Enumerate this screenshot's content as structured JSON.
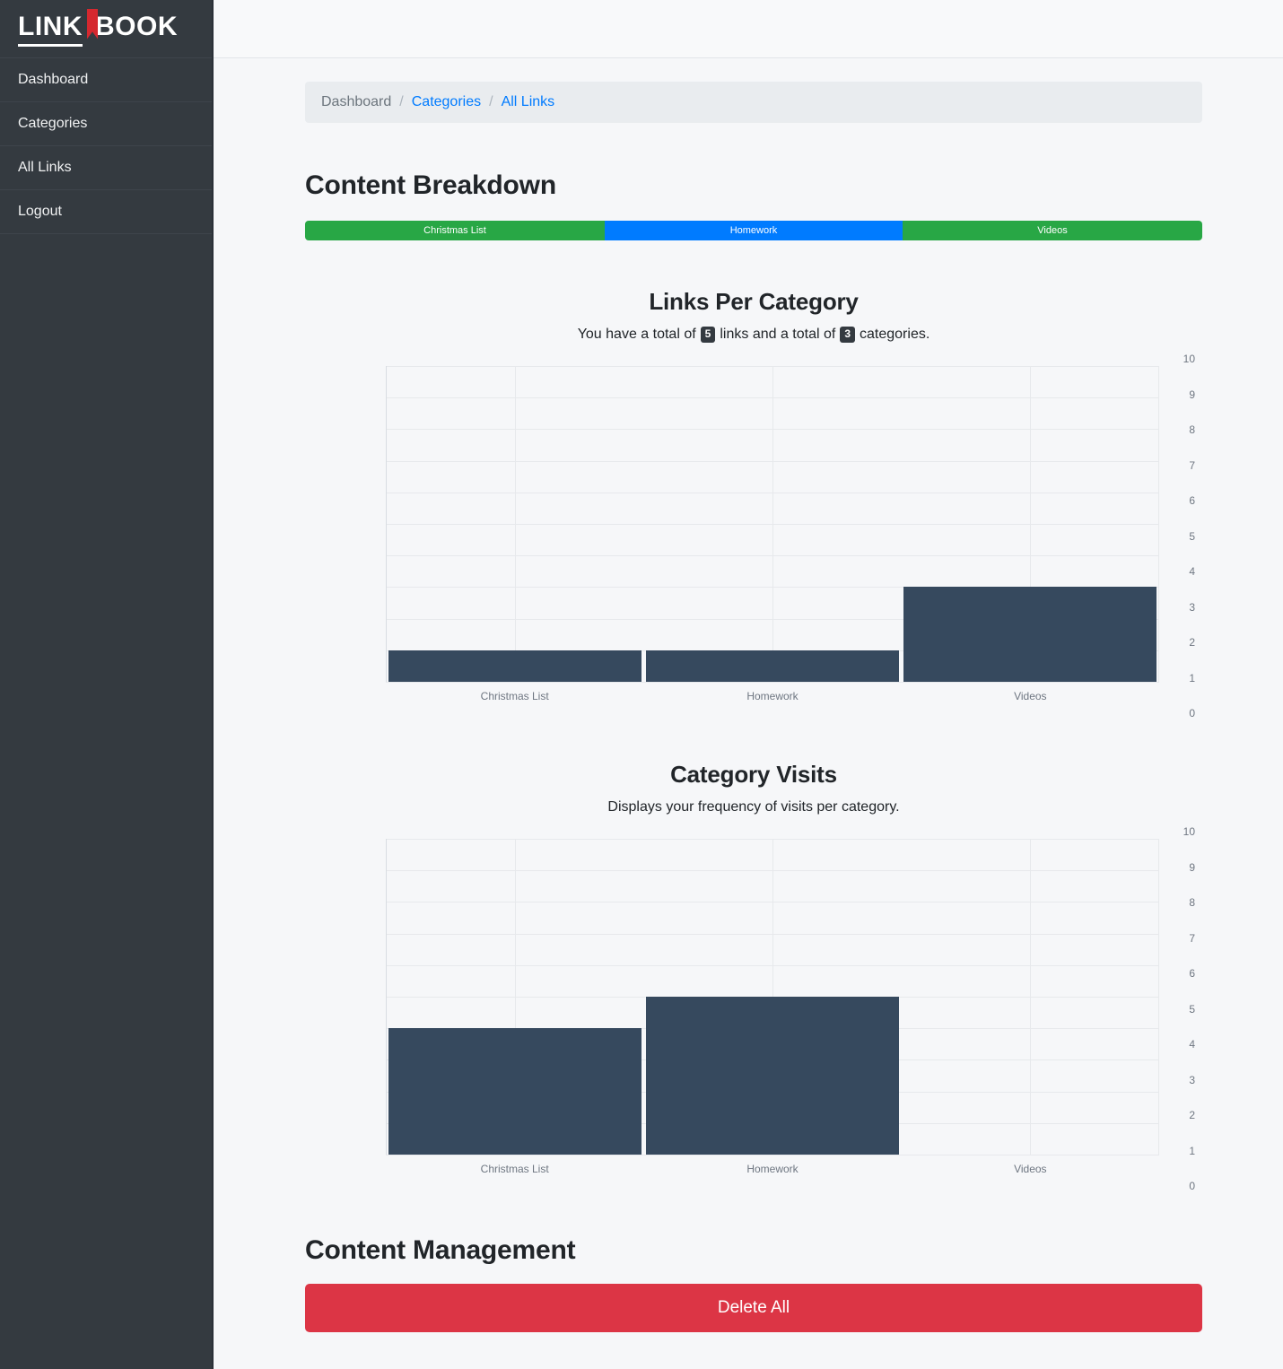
{
  "brand": {
    "part1": "LINK",
    "part2": "BOOK",
    "icon": "bookmark-icon",
    "accent_color": "#d5282f"
  },
  "sidebar": {
    "background": "#343a40",
    "items": [
      {
        "label": "Dashboard",
        "key": "dashboard"
      },
      {
        "label": "Categories",
        "key": "categories"
      },
      {
        "label": "All Links",
        "key": "all-links"
      },
      {
        "label": "Logout",
        "key": "logout"
      }
    ]
  },
  "breadcrumb": {
    "items": [
      {
        "label": "Dashboard",
        "is_link": false
      },
      {
        "label": "Categories",
        "is_link": true
      },
      {
        "label": "All Links",
        "is_link": true
      }
    ],
    "separator": "/",
    "link_color": "#007bff",
    "text_color": "#6c757d"
  },
  "page": {
    "title": "Content Breakdown"
  },
  "segment_bar": {
    "segments": [
      {
        "label": "Christmas List",
        "color": "#28a745",
        "percent": 33.4
      },
      {
        "label": "Homework",
        "color": "#007bff",
        "percent": 33.2
      },
      {
        "label": "Videos",
        "color": "#28a745",
        "percent": 33.4
      }
    ]
  },
  "chart_data": [
    {
      "type": "bar",
      "title": "Links Per Category",
      "subtitle_parts": [
        "You have a total of",
        "links and a total of",
        "categories."
      ],
      "total_links": "5",
      "total_categories": "3",
      "categories": [
        "Christmas List",
        "Homework",
        "Videos"
      ],
      "values": [
        1,
        1,
        3
      ],
      "xlabel": "",
      "ylabel": "",
      "ylim": [
        0,
        10
      ],
      "yticks": [
        0,
        1,
        2,
        3,
        4,
        5,
        6,
        7,
        8,
        9,
        10
      ],
      "grid": true,
      "legend": "none",
      "bar_color": "#36495e"
    },
    {
      "type": "bar",
      "title": "Category Visits",
      "subtitle": "Displays your frequency of visits per category.",
      "categories": [
        "Christmas List",
        "Homework",
        "Videos"
      ],
      "values": [
        4,
        5,
        0
      ],
      "xlabel": "",
      "ylabel": "",
      "ylim": [
        0,
        10
      ],
      "yticks": [
        0,
        1,
        2,
        3,
        4,
        5,
        6,
        7,
        8,
        9,
        10
      ],
      "grid": true,
      "legend": "none",
      "bar_color": "#36495e"
    }
  ],
  "management": {
    "title": "Content Management",
    "delete_all_label": "Delete All",
    "danger_color": "#dc3545"
  }
}
